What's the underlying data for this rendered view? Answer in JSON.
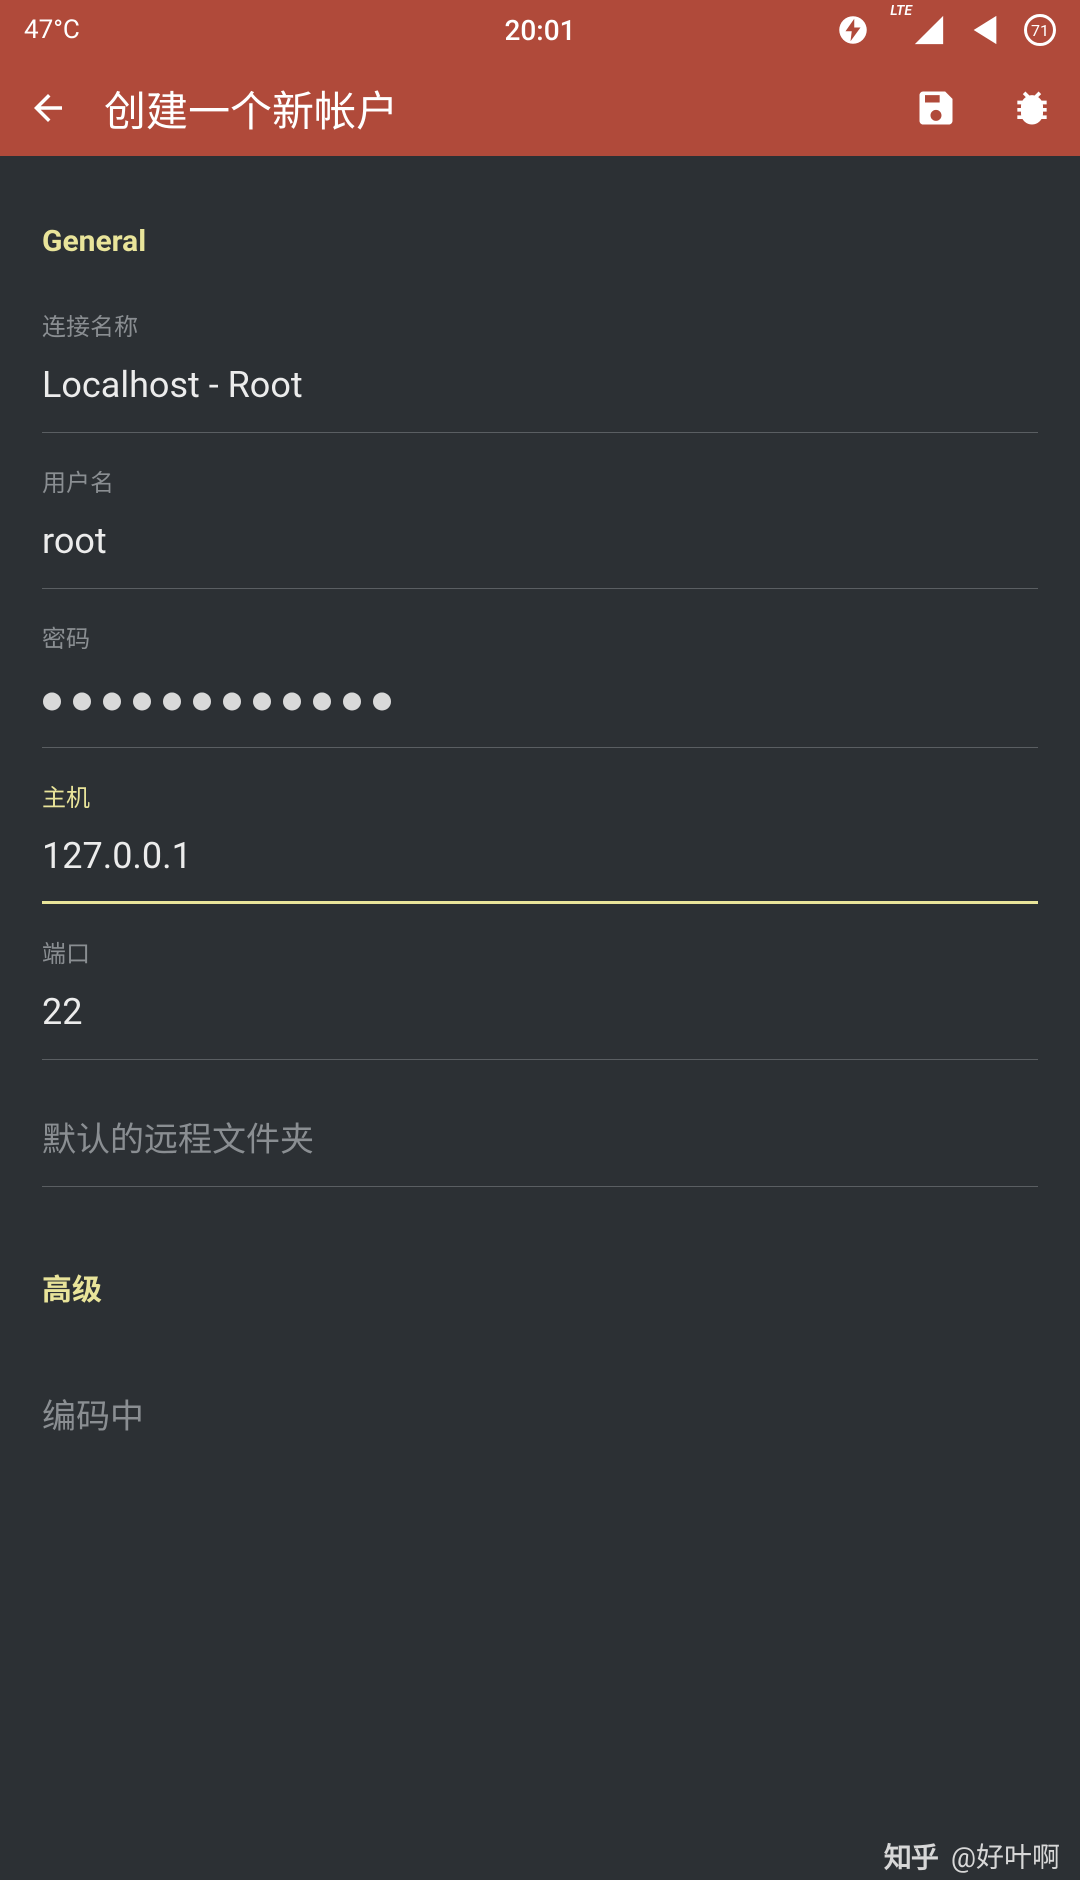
{
  "status_bar": {
    "temperature": "47°C",
    "time": "20:01",
    "battery_percent": "71"
  },
  "app_bar": {
    "title": "创建一个新帐户"
  },
  "sections": {
    "general": "General",
    "advanced": "高级"
  },
  "fields": {
    "connection_name": {
      "label": "连接名称",
      "value": "Localhost - Root"
    },
    "username": {
      "label": "用户名",
      "value": "root"
    },
    "password": {
      "label": "密码",
      "value": "●●●●●●●●●●●●"
    },
    "host": {
      "label": "主机",
      "value": "127.0.0.1"
    },
    "port": {
      "label": "端口",
      "value": "22"
    },
    "remote_folder": {
      "placeholder": "默认的远程文件夹"
    },
    "encoding": {
      "placeholder": "编码中"
    }
  },
  "watermark": {
    "site": "知乎",
    "handle": "@好叶啊"
  }
}
